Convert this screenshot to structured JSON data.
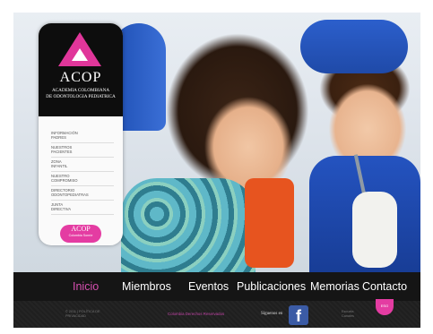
{
  "sidebar": {
    "logo_text": "ACOP",
    "logo_subtitle_line1": "ACADEMIA COLOMBIANA",
    "logo_subtitle_line2": "DE ODONTOLOGIA PEDIATRICA",
    "menu": [
      {
        "line1": "INFORMACIÓN",
        "line2": "PADRES"
      },
      {
        "line1": "NUESTROS",
        "line2": "PACIENTES"
      },
      {
        "line1": "ZONA",
        "line2": "INFANTIL"
      },
      {
        "line1": "NUESTRO",
        "line2": "COMPROMISO"
      },
      {
        "line1": "DIRECTORIO",
        "line2": "ODONTOPEDIATRAS"
      },
      {
        "line1": "JUNTA",
        "line2": "DIRECTIVA"
      }
    ],
    "cta": {
      "title": "ACOP",
      "subtitle": "Colombia Sonríe"
    }
  },
  "nav": {
    "items": [
      {
        "label": "Inicio",
        "active": true
      },
      {
        "label": "Miembros"
      },
      {
        "label": "Eventos"
      },
      {
        "label": "Publicaciones"
      },
      {
        "label": "Memorias"
      },
      {
        "label": "Contacto"
      }
    ],
    "active_color": "#d64fb0"
  },
  "footer": {
    "left_line1": "© 2011 | POLÍTICA DE",
    "left_line2": "PRIVACIDAD",
    "rights": "Colombia Derechos Reservados",
    "follow_label": "Síguenos en",
    "facebook_icon": "f",
    "right_line1": "Escuela",
    "right_line2": "Canales",
    "badge": "ESO"
  },
  "colors": {
    "brand_pink": "#e43ca2",
    "nav_bg": "#151515",
    "facebook_blue": "#3b5ba5"
  }
}
